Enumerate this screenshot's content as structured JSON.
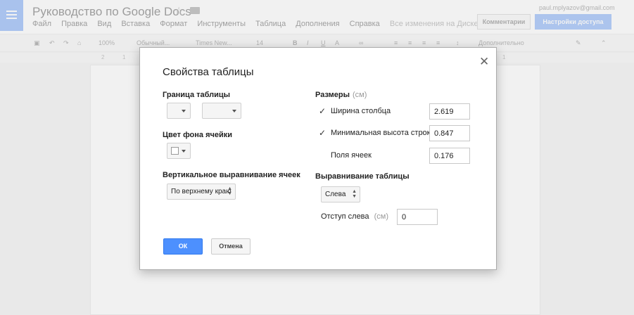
{
  "app": {
    "title": "Руководство по Google Docs",
    "user_email": "paul.mplyazov@gmail.com",
    "menu": [
      "Файл",
      "Правка",
      "Вид",
      "Вставка",
      "Формат",
      "Инструменты",
      "Таблица",
      "Дополнения",
      "Справка"
    ],
    "save_status": "Все изменения на Диске сохран...",
    "comments_button": "Комментарии",
    "share_button": "Настройки доступа",
    "toolbar": {
      "zoom": "100%",
      "style": "Обычный...",
      "font": "Times New...",
      "font_size": "14",
      "mode": "Дополнительно"
    },
    "ruler": [
      "2",
      "1",
      "1"
    ]
  },
  "dialog": {
    "title": "Свойства таблицы",
    "border_label": "Граница таблицы",
    "bg_color_label": "Цвет фона ячейки",
    "valign_label": "Вертикальное выравнивание ячеек",
    "valign_value": "По верхнему краю",
    "sizes_label": "Размеры",
    "sizes_unit": "(см)",
    "col_width": {
      "label": "Ширина столбца",
      "checked": true,
      "value": "2.619"
    },
    "min_row_height": {
      "label": "Минимальная высота строки",
      "checked": true,
      "value": "0.847"
    },
    "cell_padding": {
      "label": "Поля ячеек",
      "value": "0.176"
    },
    "table_align_label": "Выравнивание таблицы",
    "table_align_value": "Слева",
    "left_indent": {
      "label": "Отступ слева",
      "unit": "(см)",
      "value": "0"
    },
    "ok": "ОК",
    "cancel": "Отмена"
  }
}
